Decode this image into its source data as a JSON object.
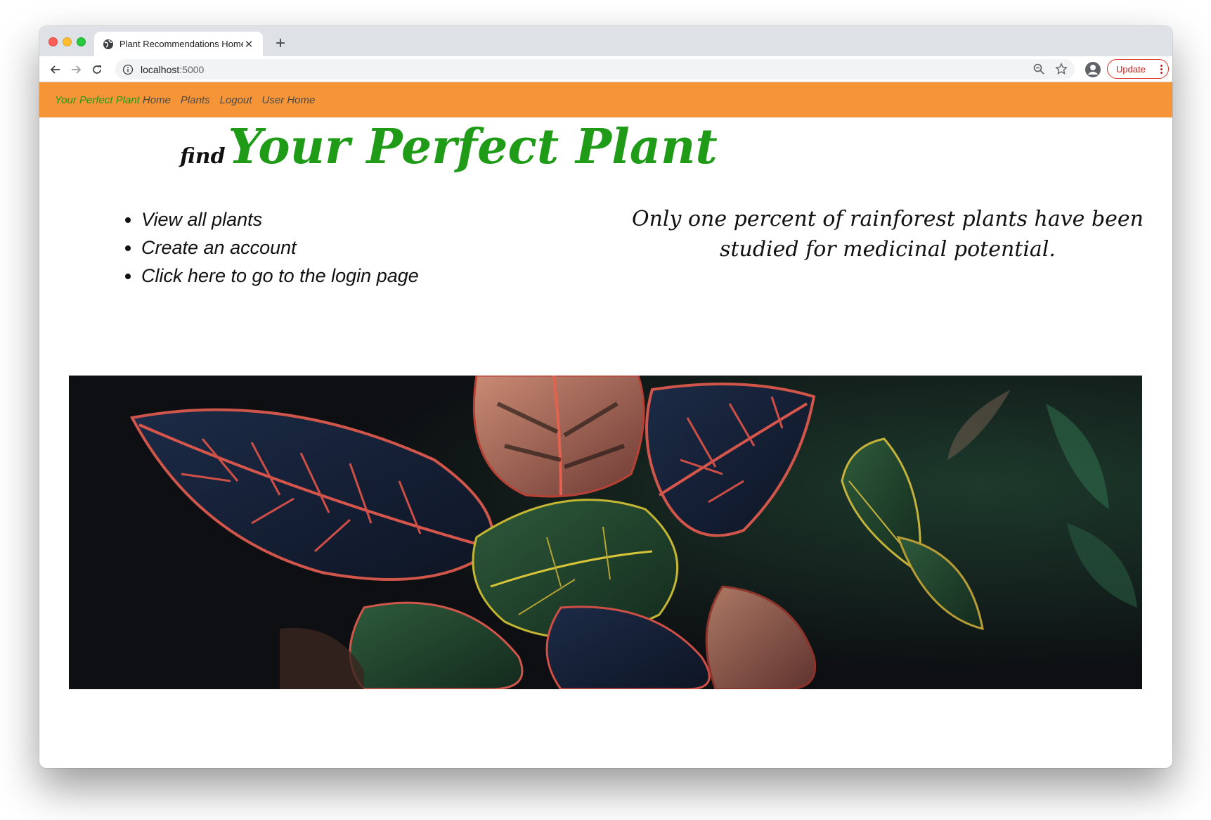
{
  "browser": {
    "tab_title": "Plant Recommendations Home",
    "url_host": "localhost",
    "url_port": ":5000",
    "update_label": "Update"
  },
  "navbar": {
    "brand": "Your Perfect Plant",
    "items": [
      {
        "label": "Home"
      },
      {
        "label": "Plants"
      },
      {
        "label": "Logout"
      },
      {
        "label": "User Home"
      }
    ],
    "background": "#f69538",
    "brand_color": "#1f9b18"
  },
  "hero": {
    "prefix": "find",
    "title": "Your Perfect Plant",
    "links": [
      {
        "label": "View all plants"
      },
      {
        "label": "Create an account"
      },
      {
        "label": "Click here to go to the login page"
      }
    ],
    "quote": "Only one percent of rainforest plants have been studied for medicinal potential."
  },
  "icons": [
    "globe-icon",
    "close-icon",
    "plus-icon",
    "back-arrow-icon",
    "forward-arrow-icon",
    "reload-icon",
    "info-icon",
    "zoom-icon",
    "star-icon",
    "profile-icon",
    "menu-dots-icon"
  ]
}
